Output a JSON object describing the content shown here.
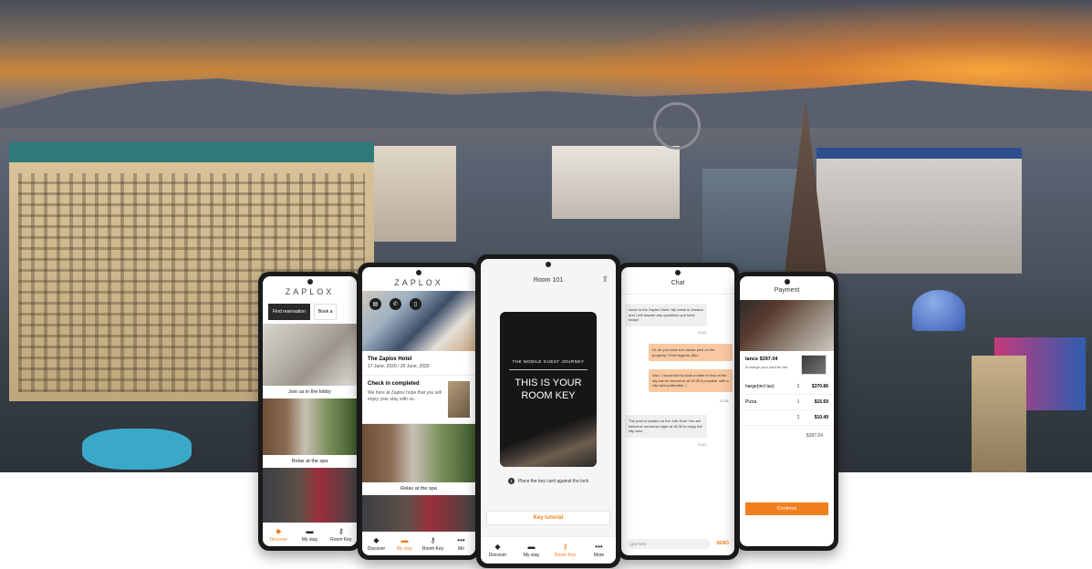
{
  "brand": {
    "logo": "ZAPLOX",
    "accent": "#f07f1e"
  },
  "phone_discover": {
    "segments": [
      "Find reservation",
      "Book a"
    ],
    "cards": [
      "Join us in the lobby",
      "Relax at the spa"
    ],
    "tabs": [
      {
        "label": "Discover",
        "icon": "tag-icon"
      },
      {
        "label": "My stay",
        "icon": "bed-icon"
      },
      {
        "label": "Room Key",
        "icon": "key-icon"
      }
    ]
  },
  "phone_mystay": {
    "hotel_name": "The Zaplox Hotel",
    "dates": "17 June, 2020 / 20 June, 2020",
    "checkin_title": "Check in completed",
    "checkin_text": "We here at Zaplox hope that you will enjoy your stay with us.",
    "card_spa": "Relax at the spa",
    "tabs": [
      {
        "label": "Discover",
        "icon": "tag-icon"
      },
      {
        "label": "My stay",
        "icon": "bed-icon"
      },
      {
        "label": "Room Key",
        "icon": "key-icon"
      },
      {
        "label": "Mo",
        "icon": "more-icon"
      }
    ]
  },
  "phone_roomkey": {
    "title": "Room 101",
    "card_subtitle": "THE MOBILE GUEST JOURNEY",
    "card_title_line1": "THIS IS YOUR",
    "card_title_line2": "ROOM KEY",
    "step_number": "1",
    "step_text": "Place the key card against the lock",
    "tutorial_button": "Key tutorial",
    "tabs": [
      {
        "label": "Discover",
        "icon": "tag-icon"
      },
      {
        "label": "My stay",
        "icon": "bed-icon"
      },
      {
        "label": "Room Key",
        "icon": "key-icon"
      },
      {
        "label": "More",
        "icon": "more-icon"
      }
    ]
  },
  "phone_chat": {
    "title": "Chat",
    "messages": [
      {
        "text": "come to the Zaplox Hotel. My name is Jessica and I will answer any questions you have today!",
        "time": "21:22"
      },
      {
        "text": "Hi, do you have a in-house pool on the property? Kind regards, Alex"
      },
      {
        "text": "Also, I would like to book a table for two at the sky bar for tomorrow at 19:30 if possible, with a city view preferably :)",
        "time": "21:36"
      },
      {
        "text": "The pool is located on the 11th floor! You are welcome tomorrow night at 19:30 to enjoy the city view.",
        "time": "21:41"
      }
    ],
    "input_placeholder": "ype here",
    "send_label": "SEND"
  },
  "phone_payment": {
    "title": "Payment",
    "balance": "lance $397.04",
    "subtext": "ill charge your card for the",
    "rows": [
      {
        "label": "harge(incl tax)",
        "qty": "2",
        "amount": "$370.86"
      },
      {
        "label": "Pizza",
        "qty": "1",
        "amount": "$15.69"
      },
      {
        "label": "",
        "qty": "2",
        "amount": "$10.49"
      }
    ],
    "total": "$397.04",
    "continue_button": "Continue"
  }
}
